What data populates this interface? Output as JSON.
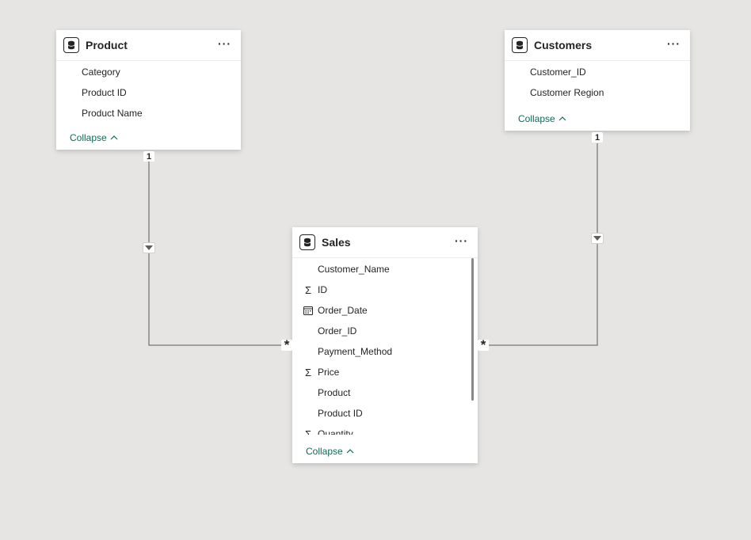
{
  "tables": {
    "product": {
      "title": "Product",
      "menu": "···",
      "fields": [
        "Category",
        "Product ID",
        "Product Name"
      ],
      "collapse": "Collapse"
    },
    "customers": {
      "title": "Customers",
      "menu": "···",
      "fields": [
        "Customer_ID",
        "Customer Region"
      ],
      "collapse": "Collapse"
    },
    "sales": {
      "title": "Sales",
      "menu": "···",
      "fields": [
        {
          "name": "Customer_Name",
          "icon": ""
        },
        {
          "name": "ID",
          "icon": "sigma-icon"
        },
        {
          "name": "Order_Date",
          "icon": "calendar-icon"
        },
        {
          "name": "Order_ID",
          "icon": ""
        },
        {
          "name": "Payment_Method",
          "icon": ""
        },
        {
          "name": "Price",
          "icon": "sigma-icon"
        },
        {
          "name": "Product",
          "icon": ""
        },
        {
          "name": "Product ID",
          "icon": ""
        },
        {
          "name": "Quantity",
          "icon": "sigma-icon"
        }
      ],
      "collapse": "Collapse"
    }
  },
  "relationships": [
    {
      "from": "Product",
      "to": "Sales",
      "from_cardinality": "1",
      "to_cardinality": "*"
    },
    {
      "from": "Customers",
      "to": "Sales",
      "from_cardinality": "1",
      "to_cardinality": "*"
    }
  ],
  "colors": {
    "canvas": "#e6e5e3",
    "collapse_link": "#0e6a57",
    "connector": "#8a8886"
  }
}
